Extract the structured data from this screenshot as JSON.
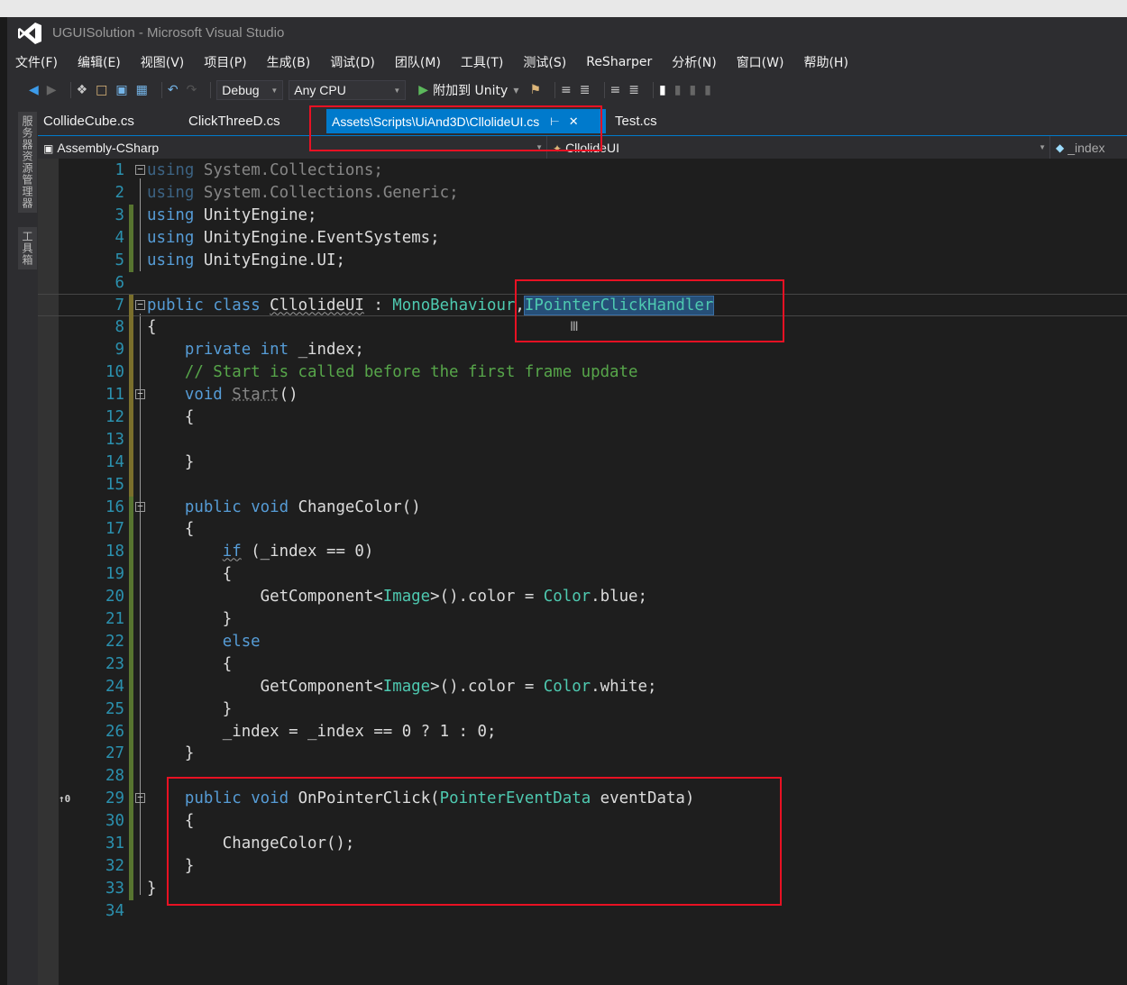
{
  "window": {
    "title": "UGUISolution - Microsoft Visual Studio",
    "logo_icon": "visual-studio-logo-icon"
  },
  "menu": [
    "文件(F)",
    "编辑(E)",
    "视图(V)",
    "项目(P)",
    "生成(B)",
    "调试(D)",
    "团队(M)",
    "工具(T)",
    "测试(S)",
    "ReSharper",
    "分析(N)",
    "窗口(W)",
    "帮助(H)"
  ],
  "toolbar": {
    "configuration": "Debug",
    "platform": "Any CPU",
    "attach_label": "附加到 Unity",
    "icons": [
      "back-icon",
      "forward-icon",
      "new-project-icon",
      "open-icon",
      "save-icon",
      "save-all-icon",
      "undo-icon",
      "redo-icon",
      "start-icon",
      "bookmark-icon"
    ]
  },
  "side_panels": [
    "服务器资源管理器",
    "工具箱"
  ],
  "tabs": [
    {
      "label": "CollideCube.cs",
      "active": false
    },
    {
      "label": "ClickThreeD.cs",
      "active": false
    },
    {
      "label": "Assets\\Scripts\\UiAnd3D\\CllolideUI.cs",
      "active": true
    },
    {
      "label": "Test.cs",
      "active": false
    }
  ],
  "navbar": {
    "project": "Assembly-CSharp",
    "type": "CllolideUI",
    "member": "_index"
  },
  "code_lines": [
    "using System.Collections;",
    "using System.Collections.Generic;",
    "using UnityEngine;",
    "using UnityEngine.EventSystems;",
    "using UnityEngine.UI;",
    "",
    "public class CllolideUI : MonoBehaviour,IPointerClickHandler",
    "{",
    "    private int _index;",
    "    // Start is called before the first frame update",
    "    void Start()",
    "    {",
    "",
    "    }",
    "",
    "    public void ChangeColor()",
    "    {",
    "        if (_index == 0)",
    "        {",
    "            GetComponent<Image>().color = Color.blue;",
    "        }",
    "        else",
    "        {",
    "            GetComponent<Image>().color = Color.white;",
    "        }",
    "        _index = _index == 0 ? 1 : 0;",
    "    }",
    "",
    "    public void OnPointerClick(PointerEventData eventData)",
    "    {",
    "        ChangeColor();",
    "    }",
    "}",
    ""
  ],
  "gutter": {
    "ref_marker": "↑0"
  },
  "colors": {
    "editor_bg": "#1e1e1e",
    "accent": "#007acc",
    "keyword": "#569cd6",
    "type": "#4ec9b0",
    "comment": "#57a64a",
    "line_number": "#2b91af",
    "annotation_box": "#e81123"
  }
}
